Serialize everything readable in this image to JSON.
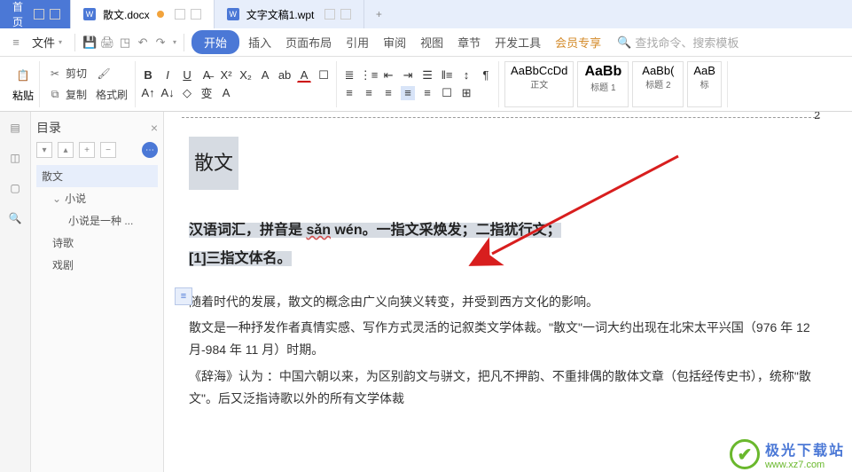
{
  "tabs": {
    "home": "首页",
    "doc1": "散文.docx",
    "doc2": "文字文稿1.wpt"
  },
  "menu": {
    "file": "文件",
    "begin": "开始",
    "items": [
      "插入",
      "页面布局",
      "引用",
      "审阅",
      "视图",
      "章节",
      "开发工具"
    ],
    "vip": "会员专享",
    "search": "查找命令、搜索模板"
  },
  "toolbar": {
    "paste": "粘贴",
    "cut": "剪切",
    "copy": "复制",
    "format_painter": "格式刷",
    "styles": {
      "normal": {
        "preview": "AaBbCcDd",
        "label": "正文"
      },
      "h1": {
        "preview": "AaBb",
        "label": "标题 1"
      },
      "h2": {
        "preview": "AaBb(",
        "label": "标题 2"
      },
      "h3": {
        "preview": "AaB",
        "label": "标"
      }
    }
  },
  "outline": {
    "title": "目录",
    "items": {
      "i0": "散文",
      "i1": "小说",
      "i2": "小说是一种 ...",
      "i3": "诗歌",
      "i4": "戏剧"
    }
  },
  "page": {
    "header_num": "2",
    "title": "散文",
    "line1a": "汉语词汇，拼音是 ",
    "pinyin1": "sǎn",
    "pinyin2": " wén",
    "line1b": "。一指文采焕发；二指犹行文；",
    "line2": "[1]三指文体名。",
    "para1": "随着时代的发展，散文的概念由广义向狭义转变，并受到西方文化的影响。",
    "para2": "散文是一种抒发作者真情实感、写作方式灵活的记叙类文学体裁。\"散文\"一词大约出现在北宋太平兴国（976 年 12 月-984 年 11 月）时期。",
    "para3": "《辞海》认为 ：中国六朝以来，为区别韵文与骈文，把凡不押韵、不重排偶的散体文章（包括经传史书），统称\"散文\"。后又泛指诗歌以外的所有文学体裁"
  },
  "watermark": {
    "cn": "极光下载站",
    "en": "www.xz7.com"
  }
}
